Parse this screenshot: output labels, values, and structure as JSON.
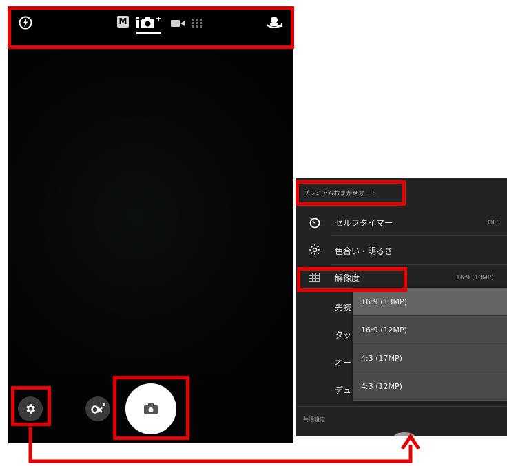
{
  "camera": {
    "modes": [
      "M",
      "iO+",
      "video",
      "grid"
    ],
    "active_mode": "iO+"
  },
  "panel": {
    "mode_title": "プレミアムおまかせオート",
    "rows": [
      {
        "label": "セルフタイマー",
        "value": "OFF",
        "icon": "timer-icon"
      },
      {
        "label": "色合い・明るさ",
        "value": "",
        "icon": "brightness-icon"
      },
      {
        "label": "解像度",
        "value": "16:9 (13MP)",
        "icon": "resolution-grid-icon"
      },
      {
        "label": "先読",
        "value": "",
        "icon": ""
      },
      {
        "label": "タッ",
        "value": "",
        "icon": ""
      },
      {
        "label": "オー",
        "value": "",
        "icon": ""
      },
      {
        "label": "デュ",
        "value": "",
        "icon": ""
      }
    ],
    "section_footer": "共通設定",
    "resolution_options": [
      "16:9 (13MP)",
      "16:9 (12MP)",
      "4:3 (17MP)",
      "4:3 (12MP)"
    ],
    "selected_resolution": "16:9 (13MP)"
  },
  "colors": {
    "highlight": "#e60000",
    "phone_bg": "#030303",
    "panel_bg": "#232323",
    "dropdown_bg": "#4a4a4a",
    "dropdown_selected": "#646464"
  }
}
